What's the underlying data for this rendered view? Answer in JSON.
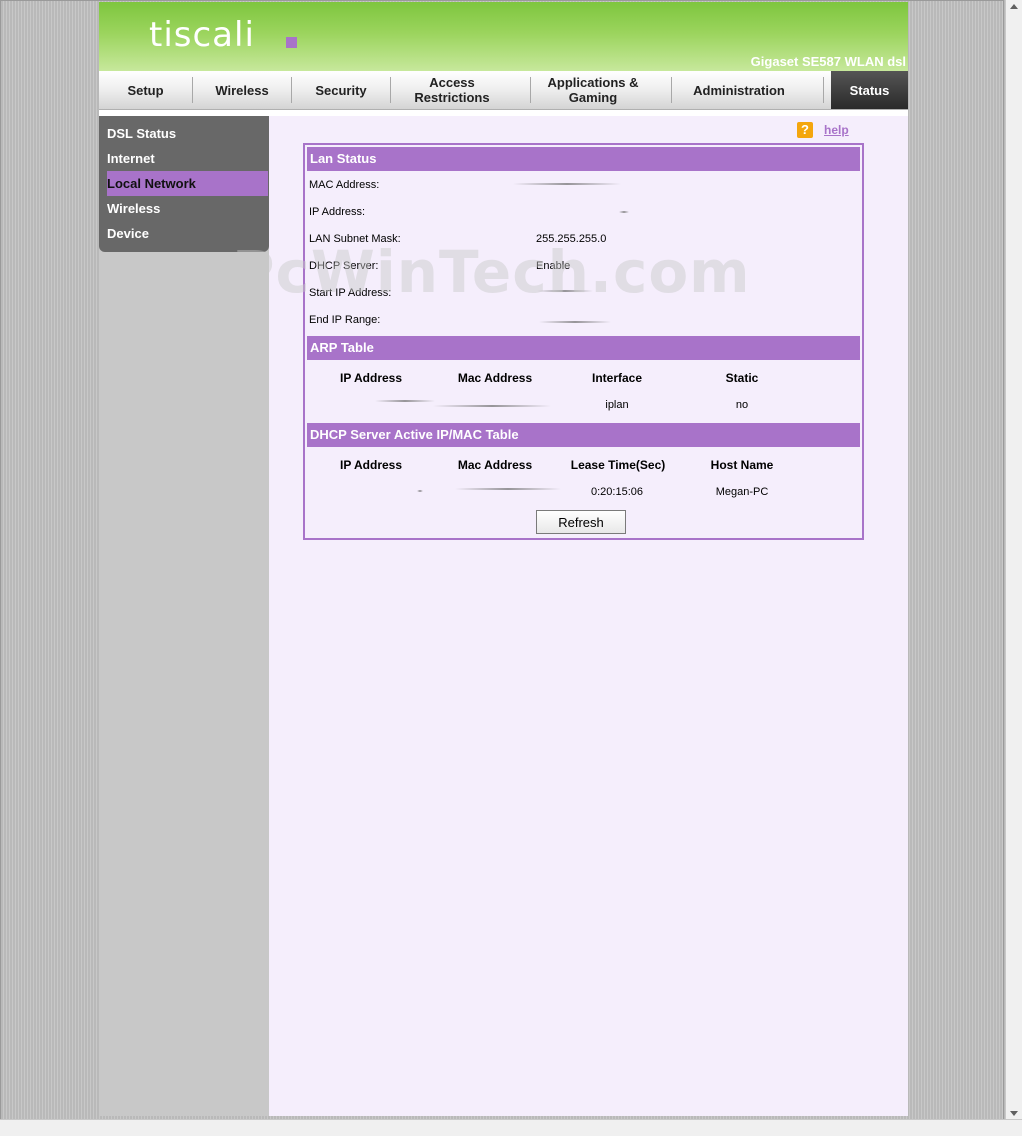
{
  "header": {
    "logo_text": "tiscali",
    "model": "Gigaset SE587 WLAN dsl",
    "brand_color": "#7ec63e",
    "accent_color": "#a873c9"
  },
  "nav": {
    "tabs": [
      {
        "label": "Setup"
      },
      {
        "label": "Wireless"
      },
      {
        "label": "Security"
      },
      {
        "label": "Access Restrictions"
      },
      {
        "label": "Applications & Gaming"
      },
      {
        "label": "Administration"
      },
      {
        "label": "Status",
        "active": true
      }
    ]
  },
  "sidebar": {
    "items": [
      {
        "label": "DSL Status"
      },
      {
        "label": "Internet"
      },
      {
        "label": "Local Network",
        "active": true
      },
      {
        "label": "Wireless"
      },
      {
        "label": "Device"
      }
    ]
  },
  "help": {
    "label": "help",
    "icon": "question-icon"
  },
  "lan_status": {
    "title": "Lan Status",
    "rows": [
      {
        "label": "MAC Address:",
        "value": ""
      },
      {
        "label": "IP Address:",
        "value": ""
      },
      {
        "label": "LAN Subnet Mask:",
        "value": "255.255.255.0"
      },
      {
        "label": "DHCP Server:",
        "value": "Enable"
      },
      {
        "label": "Start IP Address:",
        "value": ""
      },
      {
        "label": "End IP Range:",
        "value": ""
      }
    ]
  },
  "arp_table": {
    "title": "ARP Table",
    "columns": [
      "IP Address",
      "Mac Address",
      "Interface",
      "Static"
    ],
    "rows": [
      {
        "ip": "",
        "mac": "",
        "interface": "iplan",
        "static": "no"
      }
    ]
  },
  "dhcp_table": {
    "title": "DHCP Server Active IP/MAC Table",
    "columns": [
      "IP Address",
      "Mac Address",
      "Lease Time(Sec)",
      "Host Name"
    ],
    "rows": [
      {
        "ip": "",
        "mac": "",
        "lease": "0:20:15:06",
        "host": "Megan-PC"
      }
    ]
  },
  "refresh_label": "Refresh",
  "watermark": "PcWinTech.com"
}
